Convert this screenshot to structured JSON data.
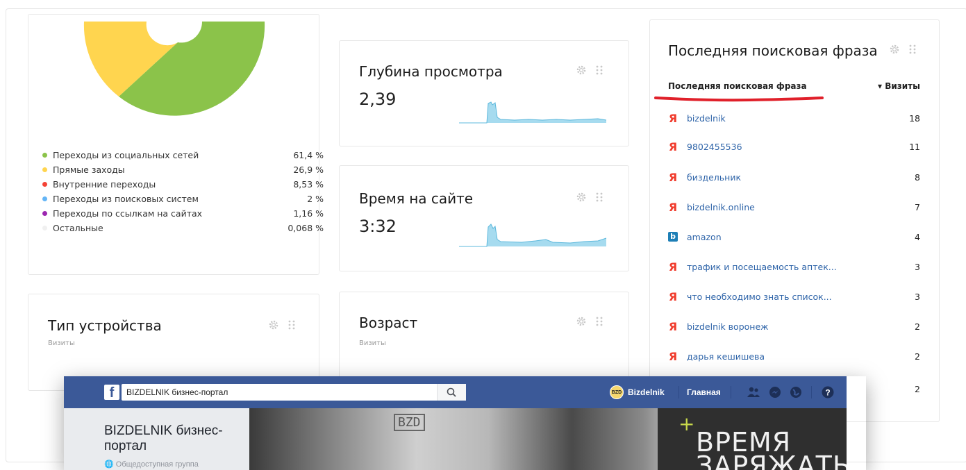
{
  "traffic_sources": {
    "legend": [
      {
        "label": "Переходы из социальных сетей",
        "value": "61,4 %",
        "color": "#8bc34a"
      },
      {
        "label": "Прямые заходы",
        "value": "26,9 %",
        "color": "#ffd54f"
      },
      {
        "label": "Внутренние переходы",
        "value": "8,53 %",
        "color": "#f44336"
      },
      {
        "label": "Переходы из поисковых систем",
        "value": "2 %",
        "color": "#64b5f6"
      },
      {
        "label": "Переходы по ссылкам на сайтах",
        "value": "1,16 %",
        "color": "#9c27b0"
      },
      {
        "label": "Остальные",
        "value": "0,068 %",
        "color": "#f0f0f0"
      }
    ]
  },
  "depth": {
    "title": "Глубина просмотра",
    "value": "2,39"
  },
  "time_on_site": {
    "title": "Время на сайте",
    "value": "3:32"
  },
  "device": {
    "title": "Тип устройства",
    "subtitle": "Визиты"
  },
  "age": {
    "title": "Возраст",
    "subtitle": "Визиты"
  },
  "search_phrases": {
    "title": "Последняя поисковая фраза",
    "col_phrase": "Последняя поисковая фраза",
    "col_visits": "▾ Визиты",
    "rows": [
      {
        "engine": "yandex",
        "phrase": "bizdelnik",
        "visits": "18"
      },
      {
        "engine": "yandex",
        "phrase": "9802455536",
        "visits": "11"
      },
      {
        "engine": "yandex",
        "phrase": "биздельник",
        "visits": "8"
      },
      {
        "engine": "yandex",
        "phrase": "bizdelnik.online",
        "visits": "7"
      },
      {
        "engine": "bing",
        "phrase": "amazon",
        "visits": "4"
      },
      {
        "engine": "yandex",
        "phrase": "трафик и посещаемость аптек...",
        "visits": "3"
      },
      {
        "engine": "yandex",
        "phrase": "что необходимо знать список...",
        "visits": "3"
      },
      {
        "engine": "yandex",
        "phrase": "bizdelnik воронеж",
        "visits": "2"
      },
      {
        "engine": "yandex",
        "phrase": "дарья кешишева",
        "visits": "2"
      },
      {
        "engine": "yandex",
        "phrase": "",
        "visits": "2"
      }
    ],
    "yandex_glyph": "Я",
    "bing_glyph": "b"
  },
  "facebook": {
    "logo": "f",
    "search_value": "BIZDELNIK бизнес-портал",
    "avatar_text": "BZD",
    "profile_name": "Bizdelnik",
    "home_label": "Главная",
    "page_name": "BIZDELNIK бизнес-портал",
    "group_type": "Общедоступная группа",
    "group_type_icon": "🌐",
    "cover_bzd": "BZD",
    "cover_text_line1": "ВРЕМЯ",
    "cover_text_line2": "ЗАРЯЖАТЬ",
    "cover_plus": "+",
    "icons": [
      "friends-icon",
      "messenger-icon",
      "globe-icon",
      "help-icon"
    ]
  }
}
